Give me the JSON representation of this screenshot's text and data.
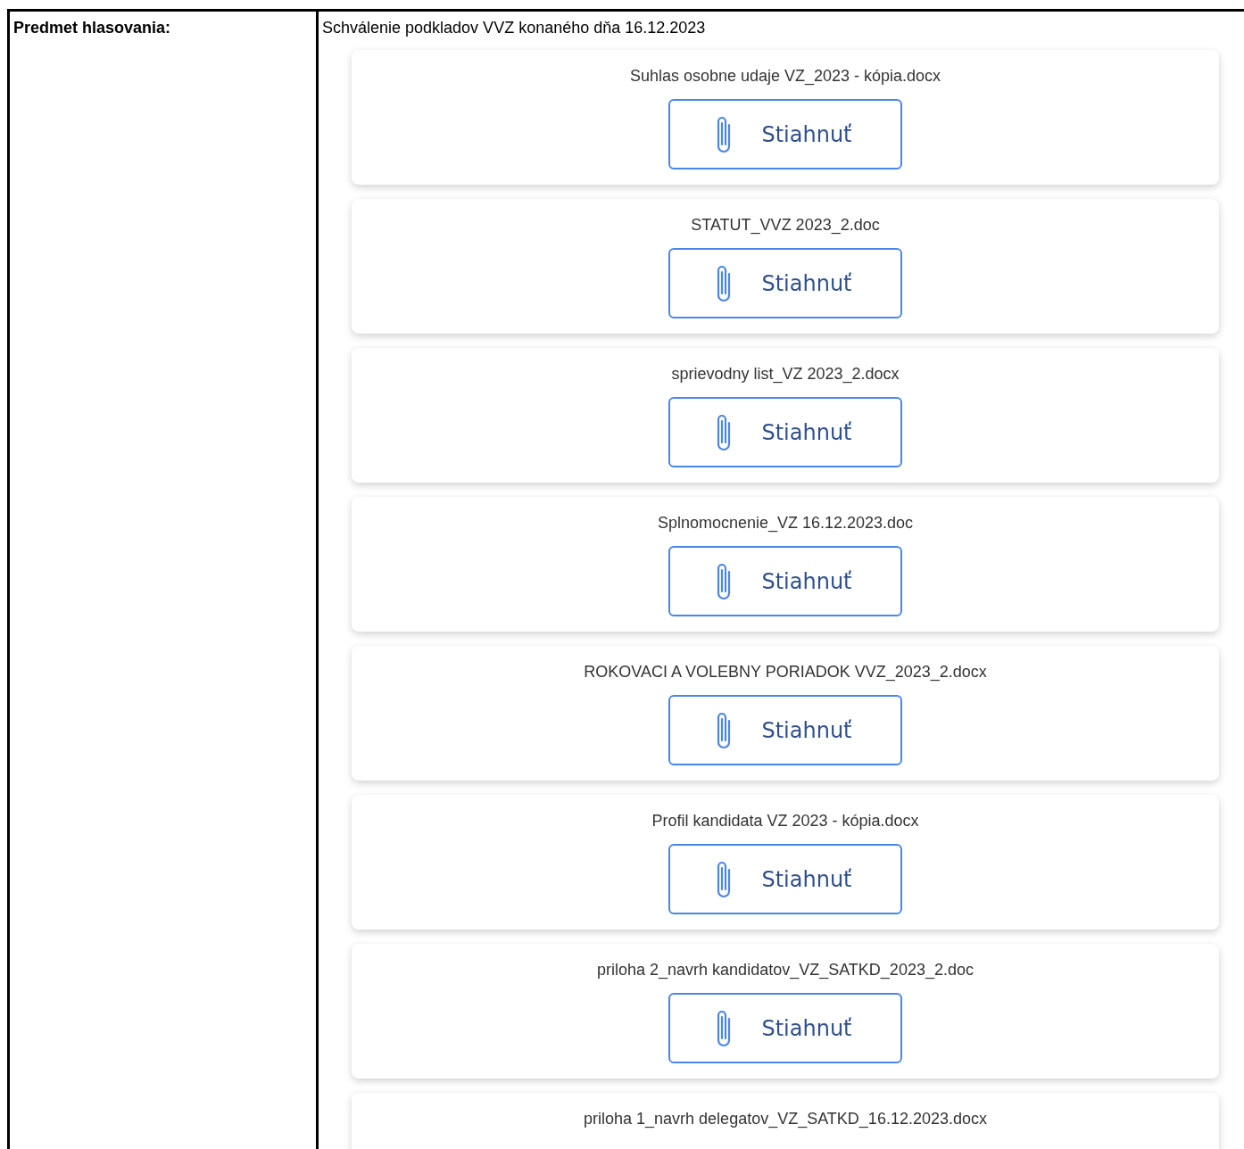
{
  "label": "Predmet hlasovania:",
  "subject": "Schválenie podkladov VVZ konaného dňa 16.12.2023",
  "attachments": [
    {
      "filename": "Suhlas osobne udaje VZ_2023 - kópia.docx",
      "button": "Stiahnuť"
    },
    {
      "filename": "STATUT_VVZ 2023_2.doc",
      "button": "Stiahnuť"
    },
    {
      "filename": "sprievodny list_VZ 2023_2.docx",
      "button": "Stiahnuť"
    },
    {
      "filename": "Splnomocnenie_VZ 16.12.2023.doc",
      "button": "Stiahnuť"
    },
    {
      "filename": "ROKOVACI A VOLEBNY PORIADOK VVZ_2023_2.docx",
      "button": "Stiahnuť"
    },
    {
      "filename": "Profil kandidata VZ 2023 - kópia.docx",
      "button": "Stiahnuť"
    },
    {
      "filename": "priloha 2_navrh kandidatov_VZ_SATKD_2023_2.doc",
      "button": "Stiahnuť"
    },
    {
      "filename": "priloha 1_navrh delegatov_VZ_SATKD_16.12.2023.docx"
    }
  ]
}
